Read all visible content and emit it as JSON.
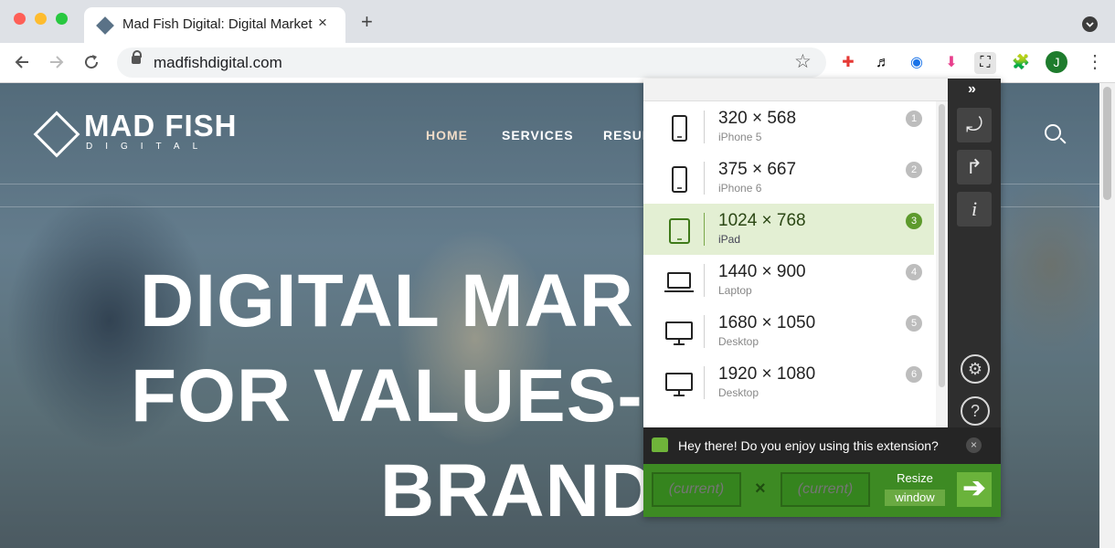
{
  "browser": {
    "tab_title": "Mad Fish Digital: Digital Market",
    "tab_close": "×",
    "new_tab": "+",
    "url": "madfishdigital.com",
    "avatar_initial": "J",
    "extensions": [
      "color-picker-icon",
      "music-icon",
      "password-icon",
      "download-icon",
      "window-resizer-icon",
      "puzzle-icon"
    ]
  },
  "site": {
    "logo_text": "MAD FISH",
    "logo_sub": "DIGITAL",
    "nav": [
      "HOME",
      "SERVICES",
      "RESUL"
    ],
    "hero_lines": [
      "DIGITAL MAR",
      "FOR VALUES-",
      "BRAND"
    ]
  },
  "popup": {
    "chevron": "»",
    "presets": [
      {
        "dim": "320 × 568",
        "name": "iPhone 5",
        "num": "1",
        "device": "phone"
      },
      {
        "dim": "375 × 667",
        "name": "iPhone 6",
        "num": "2",
        "device": "phone"
      },
      {
        "dim": "1024 × 768",
        "name": "iPad",
        "num": "3",
        "device": "tablet",
        "selected": true
      },
      {
        "dim": "1440 × 900",
        "name": "Laptop",
        "num": "4",
        "device": "laptop"
      },
      {
        "dim": "1680 × 1050",
        "name": "Desktop",
        "num": "5",
        "device": "desktop"
      },
      {
        "dim": "1920 × 1080",
        "name": "Desktop",
        "num": "6",
        "device": "desktop"
      }
    ],
    "sidebar": {
      "rotate": "⤾",
      "tools": "↱",
      "info": "i",
      "settings": "⚙",
      "help": "?"
    },
    "feedback_text": "Hey there! Do you enjoy using this extension?",
    "feedback_close": "×",
    "width_placeholder": "(current)",
    "height_placeholder": "(current)",
    "times": "×",
    "resize_label": "Resize",
    "window_label": "window",
    "go": "➔"
  }
}
